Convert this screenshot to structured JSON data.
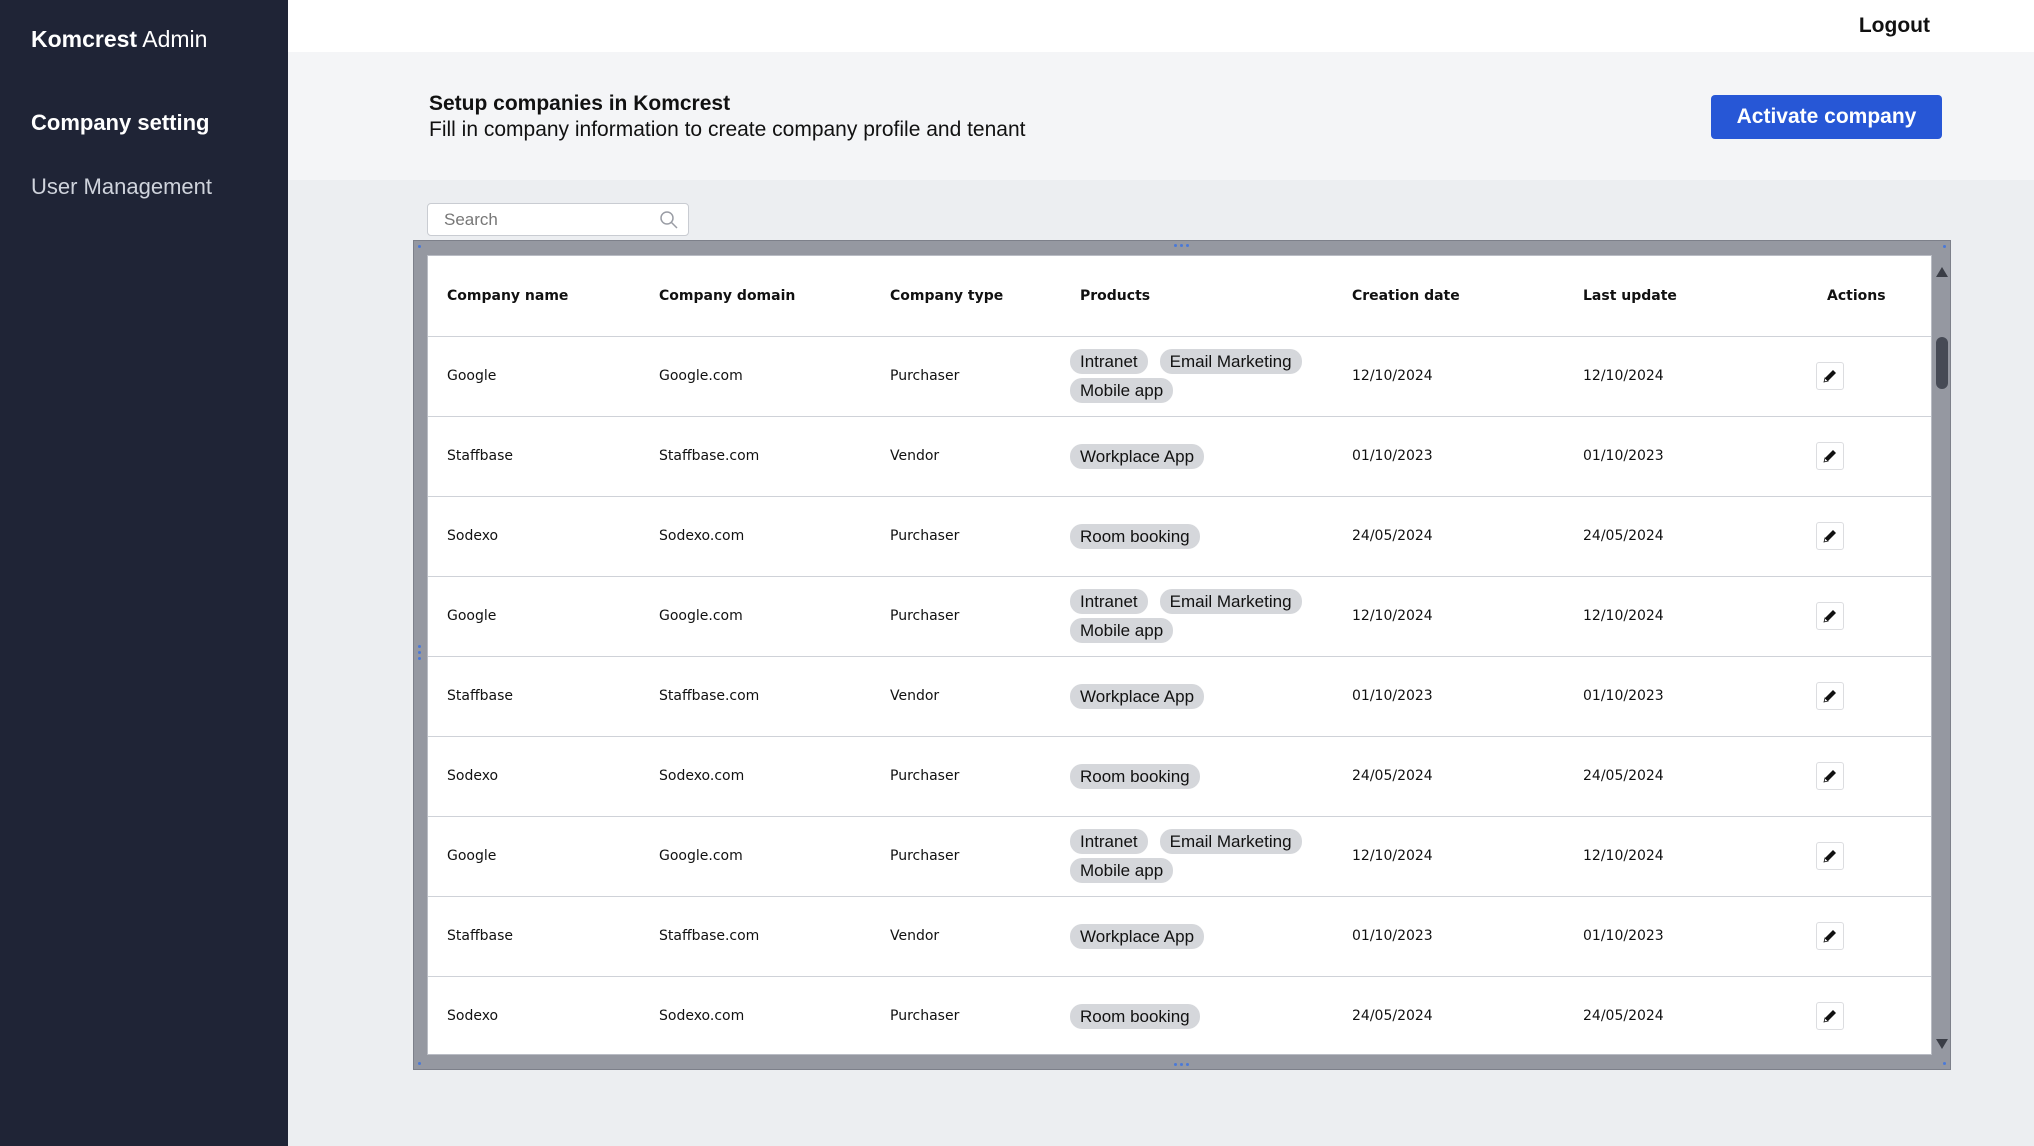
{
  "sidebar": {
    "brand_bold": "Komcrest",
    "brand_rest": " Admin",
    "items": [
      {
        "label": "Company setting"
      },
      {
        "label": "User Management"
      }
    ]
  },
  "topbar": {
    "logout_label": "Logout"
  },
  "header": {
    "title": "Setup companies in Komcrest",
    "subtitle": "Fill in company information to create company profile and tenant",
    "activate_label": "Activate company"
  },
  "search": {
    "placeholder": "Search"
  },
  "table": {
    "columns": [
      "Company name",
      "Company domain",
      "Company type",
      "Products",
      "Creation date",
      "Last update",
      "Actions"
    ],
    "rows": [
      {
        "name": "Google",
        "domain": "Google.com",
        "type": "Purchaser",
        "products": [
          "Intranet",
          "Email Marketing",
          "Mobile app"
        ],
        "created": "12/10/2024",
        "updated": "12/10/2024"
      },
      {
        "name": "Staffbase",
        "domain": "Staffbase.com",
        "type": "Vendor",
        "products": [
          "Workplace App"
        ],
        "created": "01/10/2023",
        "updated": "01/10/2023"
      },
      {
        "name": "Sodexo",
        "domain": "Sodexo.com",
        "type": "Purchaser",
        "products": [
          "Room booking"
        ],
        "created": "24/05/2024",
        "updated": "24/05/2024"
      },
      {
        "name": "Google",
        "domain": "Google.com",
        "type": "Purchaser",
        "products": [
          "Intranet",
          "Email Marketing",
          "Mobile app"
        ],
        "created": "12/10/2024",
        "updated": "12/10/2024"
      },
      {
        "name": "Staffbase",
        "domain": "Staffbase.com",
        "type": "Vendor",
        "products": [
          "Workplace App"
        ],
        "created": "01/10/2023",
        "updated": "01/10/2023"
      },
      {
        "name": "Sodexo",
        "domain": "Sodexo.com",
        "type": "Purchaser",
        "products": [
          "Room booking"
        ],
        "created": "24/05/2024",
        "updated": "24/05/2024"
      },
      {
        "name": "Google",
        "domain": "Google.com",
        "type": "Purchaser",
        "products": [
          "Intranet",
          "Email Marketing",
          "Mobile app"
        ],
        "created": "12/10/2024",
        "updated": "12/10/2024"
      },
      {
        "name": "Staffbase",
        "domain": "Staffbase.com",
        "type": "Vendor",
        "products": [
          "Workplace App"
        ],
        "created": "01/10/2023",
        "updated": "01/10/2023"
      },
      {
        "name": "Sodexo",
        "domain": "Sodexo.com",
        "type": "Purchaser",
        "products": [
          "Room booking"
        ],
        "created": "24/05/2024",
        "updated": "24/05/2024"
      }
    ],
    "action_icon": "pencil-icon"
  },
  "colors": {
    "sidebar_bg": "#1f2436",
    "accent": "#2757d6",
    "chip_bg": "#d5d7db"
  }
}
